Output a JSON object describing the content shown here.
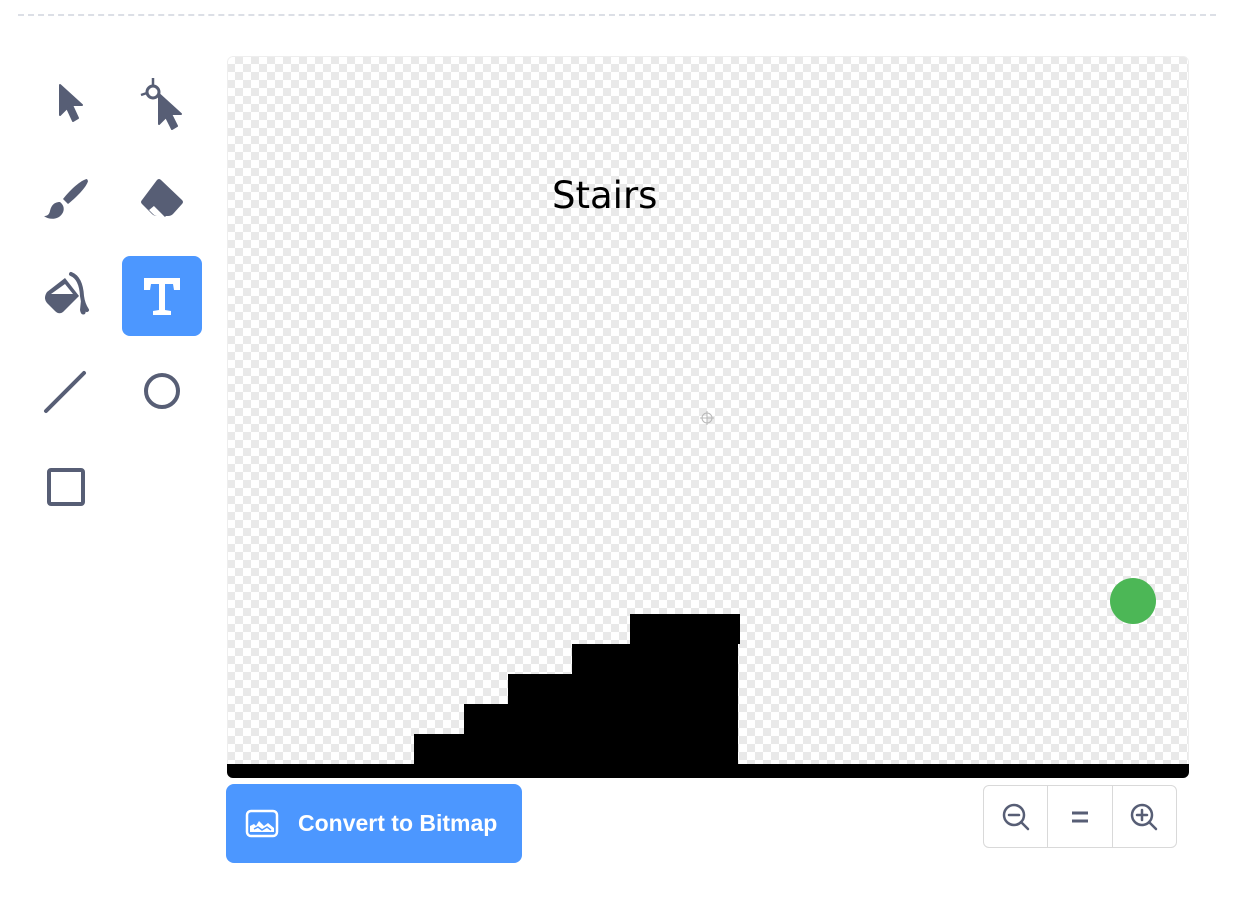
{
  "canvas": {
    "text_object": "Stairs"
  },
  "tools": {
    "selected": "text",
    "items": [
      "select",
      "reshape",
      "brush",
      "eraser",
      "fill",
      "text",
      "line",
      "circle",
      "rectangle"
    ]
  },
  "bottom_bar": {
    "convert_label": "Convert to Bitmap",
    "zoom_controls": [
      "zoom-out",
      "reset-zoom",
      "zoom-in"
    ]
  },
  "colors": {
    "accent": "#4c97ff",
    "icon_gray": "#575e75",
    "ball_green": "#4cb756",
    "stairs_black": "#000000"
  }
}
